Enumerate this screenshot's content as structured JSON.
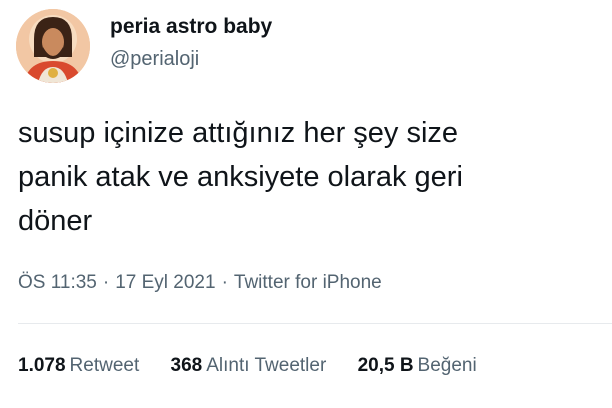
{
  "user": {
    "display_name": "peria astro baby",
    "handle": "@perialoji",
    "avatar_icon": "profile-avatar"
  },
  "tweet": {
    "lines": [
      "susup içinize attığınız her şey size",
      "panik atak ve anksiyete olarak geri",
      "döner"
    ]
  },
  "meta": {
    "time": "ÖS 11:35",
    "date": "17 Eyl 2021",
    "source": "Twitter for iPhone",
    "separator": "·"
  },
  "stats": {
    "retweets": {
      "value": "1.078",
      "label": "Retweet"
    },
    "quotes": {
      "value": "368",
      "label": "Alıntı Tweetler"
    },
    "likes": {
      "value": "20,5 B",
      "label": "Beğeni"
    }
  },
  "colors": {
    "text": "#0f1419",
    "secondary": "#536471",
    "divider": "#e7eaed"
  }
}
